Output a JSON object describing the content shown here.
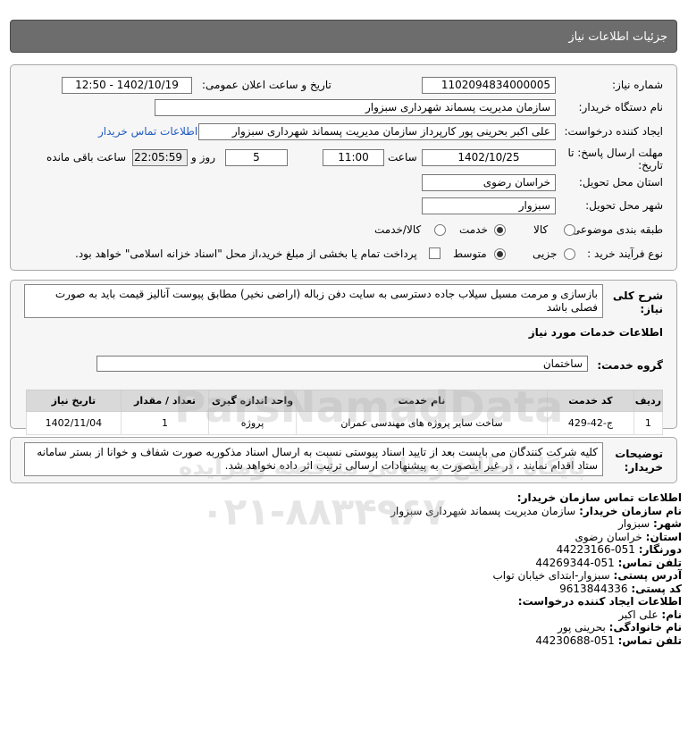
{
  "header": {
    "title": "جزئیات اطلاعات نیاز"
  },
  "form": {
    "need_number_label": "شماره نیاز:",
    "need_number": "1102094834000005",
    "announce_label": "تاریخ و ساعت اعلان عمومی:",
    "announce_value": "1402/10/19 - 12:50",
    "buyer_org_label": "نام دستگاه خریدار:",
    "buyer_org": "سازمان مدیریت پسماند شهرداری سبزوار",
    "creator_label": "ایجاد کننده درخواست:",
    "creator": "علی اکبر بحرینی پور کارپرداز سازمان مدیریت پسماند شهرداری سبزوار",
    "contact_link": "اطلاعات تماس خریدار",
    "deadline_label_1": "مهلت ارسال پاسخ: تا",
    "deadline_label_2": "تاریخ:",
    "deadline_date": "1402/10/25",
    "time_label": "ساعت",
    "deadline_time": "11:00",
    "days": "5",
    "days_label": "روز و",
    "remaining_time": "22:05:59",
    "remaining_label": "ساعت باقی مانده",
    "province_label": "استان محل تحویل:",
    "province": "خراسان رضوی",
    "city_label": "شهر محل تحویل:",
    "city": "سبزوار",
    "category_label": "طبقه بندی موضوعی:",
    "category_options": [
      "کالا",
      "خدمت",
      "کالا/خدمت"
    ],
    "category_selected": "خدمت",
    "process_label": "نوع فرآیند خرید :",
    "process_options": [
      "جزیی",
      "متوسط"
    ],
    "process_selected": "متوسط",
    "payment_note": "پرداخت تمام یا بخشی از مبلغ خرید،از محل \"اسناد خزانه اسلامی\" خواهد بود."
  },
  "description": {
    "label_1": "شرح کلی",
    "label_2": "نیاز:",
    "text_1": "بازسازی و مرمت مسیل سیلاب جاده دسترسی به سایت دفن زباله (اراضی نخیر) مطابق پیوست آنالیز قیمت باید به صورت",
    "text_2": "فصلی باشد",
    "services_title": "اطلاعات خدمات مورد نیاز",
    "group_label": "گروه خدمت:",
    "group_value": "ساختمان"
  },
  "table": {
    "headers": [
      "ردیف",
      "کد خدمت",
      "نام خدمت",
      "واحد اندازه گیری",
      "تعداد / مقدار",
      "تاریخ نیاز"
    ],
    "rows": [
      [
        "1",
        "ج-42-429",
        "ساخت سایر پروژه های مهندسی عمران",
        "پروژه",
        "1",
        "1402/11/04"
      ]
    ]
  },
  "notes": {
    "label_1": "توضیحات",
    "label_2": "خریدار:",
    "text_1": "کلیه شرکت کنندگان می بایست بعد از تایید اسناد پیوستی نسبت به ارسال اسناد مذکوربه صورت شفاف و خوانا از بستر سامانه",
    "text_2": "ستاد اقدام نمایند ، در غیر اینصورت به پیشنهادات ارسالی ترتیب اثر داده نخواهد شد."
  },
  "contact": {
    "title": "اطلاعات تماس سازمان خریدار:",
    "org_label": "نام سازمان خریدار:",
    "org": "سازمان مدیریت پسماند شهرداری سبزوار",
    "city_label": "شهر:",
    "city": "سبزوار",
    "province_label": "استان:",
    "province": "خراسان رضوی",
    "fax_label": "دورنگار:",
    "fax": "051-44223166",
    "phone_label": "تلفن تماس:",
    "phone": "051-44269344",
    "address_label": "آدرس پستی:",
    "address": "سبزوار-ابتدای خیابان تواب",
    "postal_label": "کد پستی:",
    "postal": "9613844336",
    "creator_title": "اطلاعات ایجاد کننده درخواست:",
    "name_label": "نام:",
    "name": "علی اکبر",
    "family_label": "نام خانوادگی:",
    "family": "بحرینی پور",
    "creator_phone_label": "تلفن تماس:",
    "creator_phone": "051-44230688"
  },
  "watermark": {
    "brand": "ParsNamadData",
    "subtitle": "پایگاه اطلاع رسانی مناقصه ومزایده",
    "phone": "۰۲۱-۸۸۳۴۹۶۷۰"
  },
  "colors": {
    "header_bg": "#6d6d6d",
    "link": "#1f5bc2",
    "panel_bg": "#f6f6f6"
  }
}
